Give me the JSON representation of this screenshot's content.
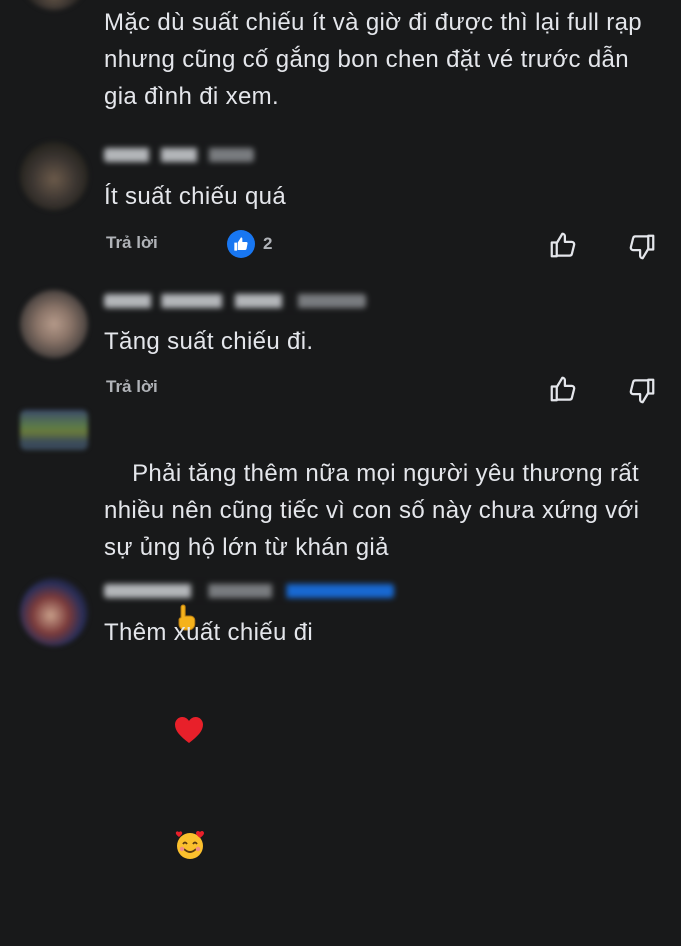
{
  "comments": [
    {
      "text": "Mặc dù suất chiếu ít và giờ đi được thì lại full rạp nhưng cũng cố gắng bon chen đặt vé trước dẫn gia đình đi xem."
    },
    {
      "text": "Ít suất chiếu quá",
      "reply_label": "Trả lời",
      "like_count": "2"
    },
    {
      "text": "Tăng suất chiếu đi.",
      "reply_label": "Trả lời"
    },
    {
      "text": "Phải tăng thêm nữa mọi người yêu thương rất nhiều nên cũng tiếc vì con số này chưa xứng với sự ủng hộ lớn từ khán giả"
    },
    {
      "text": "Thêm xuất chiếu đi"
    }
  ],
  "colors": {
    "background": "#18191a",
    "text": "#e4e6eb",
    "secondary_text": "#b0b3b8",
    "like_blue": "#1877f2"
  },
  "icons": [
    "like-reaction-icon",
    "thumbs-up-icon",
    "thumbs-down-icon",
    "point-up-hand-emoji",
    "red-heart-emoji",
    "smiling-face-with-hearts-emoji"
  ]
}
